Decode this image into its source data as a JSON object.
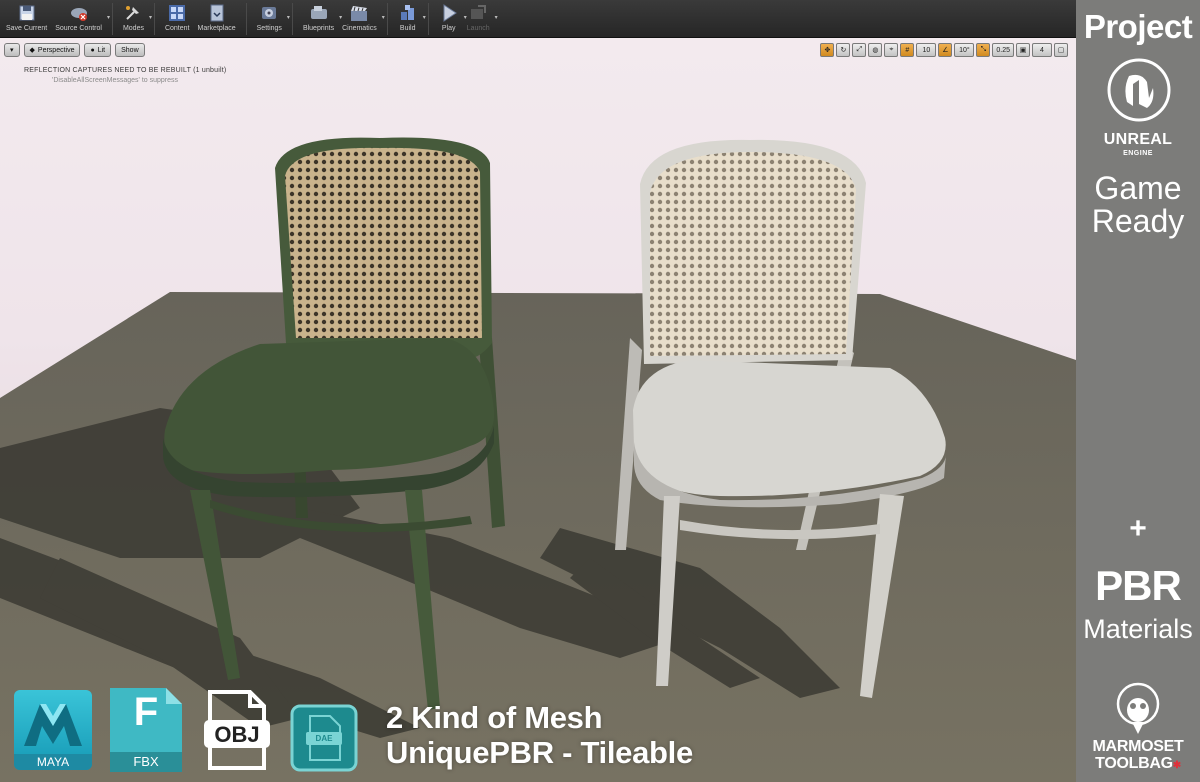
{
  "toolbar": {
    "buttons": [
      {
        "label": "Save Current"
      },
      {
        "label": "Source Control"
      },
      {
        "label": "Modes"
      },
      {
        "label": "Content"
      },
      {
        "label": "Marketplace"
      },
      {
        "label": "Settings"
      },
      {
        "label": "Blueprints"
      },
      {
        "label": "Cinematics"
      },
      {
        "label": "Build"
      },
      {
        "label": "Play"
      },
      {
        "label": "Launch"
      }
    ]
  },
  "viewport": {
    "perspective_label": "Perspective",
    "lit_label": "Lit",
    "show_label": "Show",
    "grid_snap_value": "10",
    "rotation_snap_value": "10°",
    "scale_snap_value": "0.25",
    "camera_speed_value": "4",
    "warning_message": "REFLECTION CAPTURES NEED TO BE REBUILT (1 unbuilt)",
    "suppress_message": "'DisableAllScreenMessages' to suppress"
  },
  "sidepanel": {
    "project_label": "Project",
    "engine_name": "UNREAL",
    "engine_sub": "ENGINE",
    "game_line1": "Game",
    "game_line2": "Ready",
    "plus": "+",
    "pbr": "PBR",
    "materials": "Materials",
    "marmoset_line1": "MARMOSET",
    "marmoset_line2": "TOOLBAG"
  },
  "formats": {
    "maya_label": "MAYA",
    "fbx_label": "FBX",
    "fbx_letter": "F",
    "obj_label": "OBJ",
    "dae_label": "DAE"
  },
  "caption": {
    "line1": "2 Kind of Mesh",
    "line2": "UniquePBR - Tileable"
  },
  "colors": {
    "green_chair": "#435638",
    "white_chair": "#d6d5d0",
    "floor": "#6e6a5c",
    "panel": "#7c7c7a"
  }
}
